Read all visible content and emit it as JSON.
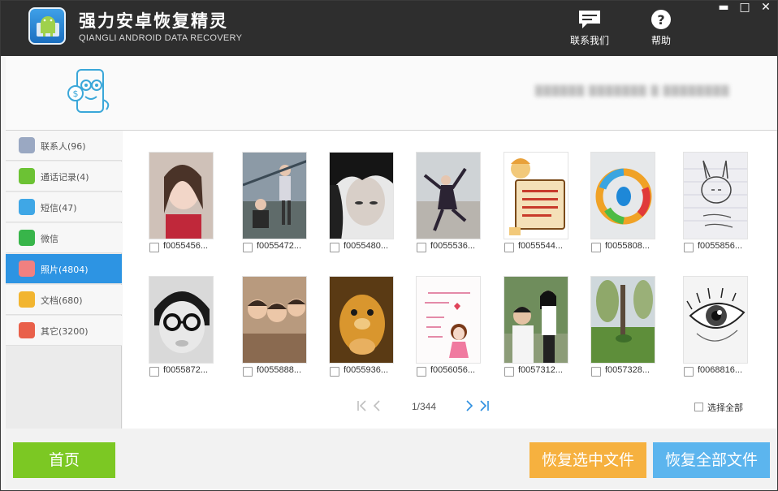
{
  "app": {
    "title": "强力安卓恢复精灵",
    "subtitle": "QIANGLI ANDROID DATA RECOVERY"
  },
  "toolbar": {
    "contact_label": "联系我们",
    "help_label": "帮助"
  },
  "window_controls": {
    "minimize": "▬",
    "maximize": "□",
    "close": "✕"
  },
  "device": {
    "info": "▒▒▒▒▒▒ ▒▒▒▒▒▒▒ ▒ ▒▒▒▒▒▒▒▒"
  },
  "sidebar": {
    "items": [
      {
        "label": "联系人(96)",
        "icon": "contacts-icon",
        "color": "#9aa8c2"
      },
      {
        "label": "通话记录(4)",
        "icon": "call-log-icon",
        "color": "#6cc234"
      },
      {
        "label": "短信(47)",
        "icon": "sms-icon",
        "color": "#3fa7e6"
      },
      {
        "label": "微信",
        "icon": "wechat-icon",
        "color": "#38b54a"
      },
      {
        "label": "照片(4804)",
        "icon": "photo-icon",
        "color": "#f08080",
        "active": true
      },
      {
        "label": "文档(680)",
        "icon": "document-icon",
        "color": "#f2b530"
      },
      {
        "label": "其它(3200)",
        "icon": "other-icon",
        "color": "#e9604a"
      }
    ]
  },
  "photos": [
    {
      "name": "f0055456..."
    },
    {
      "name": "f0055472..."
    },
    {
      "name": "f0055480..."
    },
    {
      "name": "f0055536..."
    },
    {
      "name": "f0055544..."
    },
    {
      "name": "f0055808..."
    },
    {
      "name": "f0055856..."
    },
    {
      "name": "f0055872..."
    },
    {
      "name": "f0055888..."
    },
    {
      "name": "f0055936..."
    },
    {
      "name": "f0056056..."
    },
    {
      "name": "f0057312..."
    },
    {
      "name": "f0057328..."
    },
    {
      "name": "f0068816..."
    }
  ],
  "pagination": {
    "page_text": "1/344"
  },
  "select_all_label": "选择全部",
  "buttons": {
    "home": "首页",
    "recover_selected": "恢复选中文件",
    "recover_all": "恢复全部文件"
  },
  "colors": {
    "titlebar": "#2e2e2e",
    "active_tab": "#2d94e3",
    "home_button": "#7cc823",
    "recover_selected_button": "#f6b13f",
    "recover_all_button": "#5cb5ee"
  }
}
